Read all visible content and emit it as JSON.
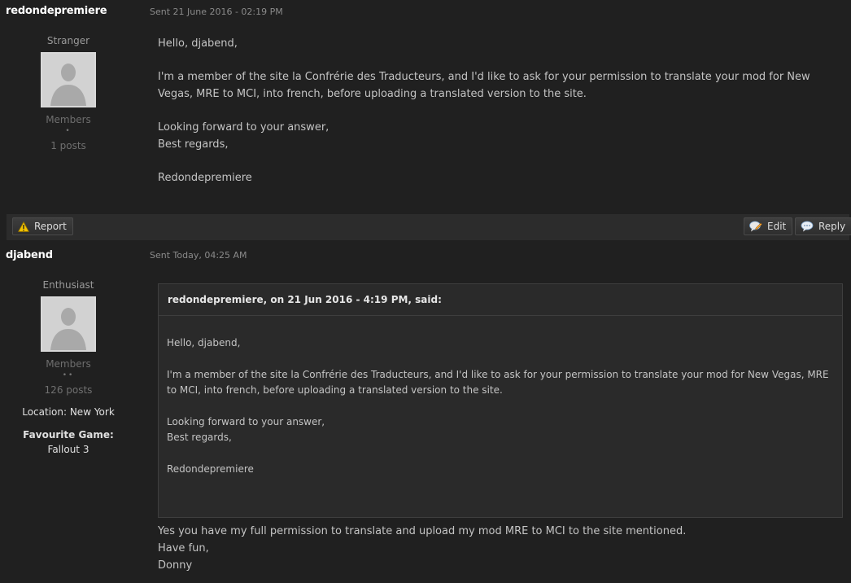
{
  "posts": [
    {
      "author": "redondepremiere",
      "date": "Sent 21 June 2016 - 02:19 PM",
      "title": "Stranger",
      "group": "Members",
      "pips": "•",
      "post_count": "1 posts",
      "body": {
        "greeting": "Hello, djabend,",
        "paragraph": "I'm a member of the site la Confrérie des Traducteurs, and I'd like to ask for your permission to translate your mod for New Vegas, MRE to MCI, into french, before uploading a translated version to the site.",
        "closing1": "Looking forward to your answer,",
        "closing2": "Best regards,",
        "signature": "Redondepremiere"
      }
    },
    {
      "author": "djabend",
      "date": "Sent Today, 04:25 AM",
      "title": "Enthusiast",
      "group": "Members",
      "pips": "••",
      "post_count": "126 posts",
      "location": "Location: New York",
      "fav_label": "Favourite Game:",
      "fav_value": "Fallout 3",
      "quote": {
        "citation": "redondepremiere, on 21 Jun 2016 - 4:19 PM, said:",
        "greeting": "Hello, djabend,",
        "paragraph": "I'm a member of the site la Confrérie des Traducteurs, and I'd like to ask for your permission to translate your mod for New Vegas, MRE to MCI, into french, before uploading a translated version to the site.",
        "closing1": "Looking forward to your answer,",
        "closing2": "Best regards,",
        "signature": "Redondepremiere"
      },
      "reply": {
        "line1": "Yes you have my full permission to translate and upload my mod MRE to MCI to the site mentioned.",
        "line2": "Have fun,",
        "line3": "Donny"
      }
    }
  ],
  "controls": {
    "report_label": "Report",
    "edit_label": "Edit",
    "reply_label": "Reply",
    "report_icon": "warning-icon",
    "edit_icon": "edit-bubble-icon",
    "reply_icon": "reply-bubble-icon"
  }
}
